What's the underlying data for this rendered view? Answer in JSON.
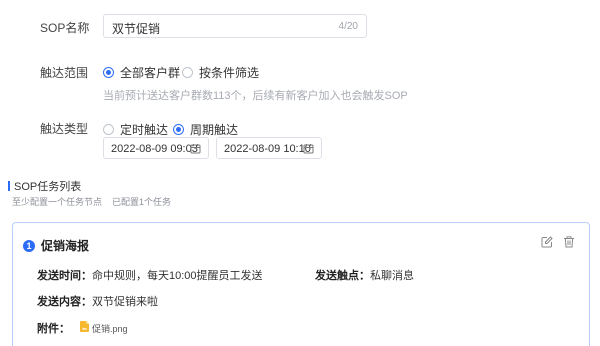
{
  "form": {
    "name_label": "SOP名称",
    "name_value": "双节促销",
    "name_count": "4/20",
    "scope_label": "触达范围",
    "scope_options": [
      "全部客户群",
      "按条件筛选"
    ],
    "scope_selected": "全部客户群",
    "scope_hint": "当前预计送达客户群数113个，后续有新客户加入也会触发SOP",
    "type_label": "触达类型",
    "type_options": [
      "定时触达",
      "周期触达"
    ],
    "type_selected": "周期触达",
    "date_start": "2022-08-09 09:03",
    "date_end": "2022-08-09 10:10"
  },
  "tasks": {
    "title": "SOP任务列表",
    "note_min": "至少配置一个任务节点",
    "note_count": "已配置1个任务",
    "card": {
      "index": "1",
      "title": "促销海报",
      "send_time_label": "发送时间：",
      "send_time_value": "命中规则，每天10:00提醒员工发送",
      "send_channel_label": "发送触点：",
      "send_channel_value": "私聊消息",
      "content_label": "发送内容：",
      "content_value": "双节促销来啦",
      "attach_label": "附件：",
      "attach_file": "促销.png"
    }
  },
  "icons": {
    "calendar": "calendar-icon",
    "edit": "edit-icon",
    "delete": "trash-icon",
    "file": "image-file-icon"
  },
  "colors": {
    "accent": "#2d6cf6",
    "card_border": "#b9cff8",
    "file_icon": "#f5b82e"
  }
}
